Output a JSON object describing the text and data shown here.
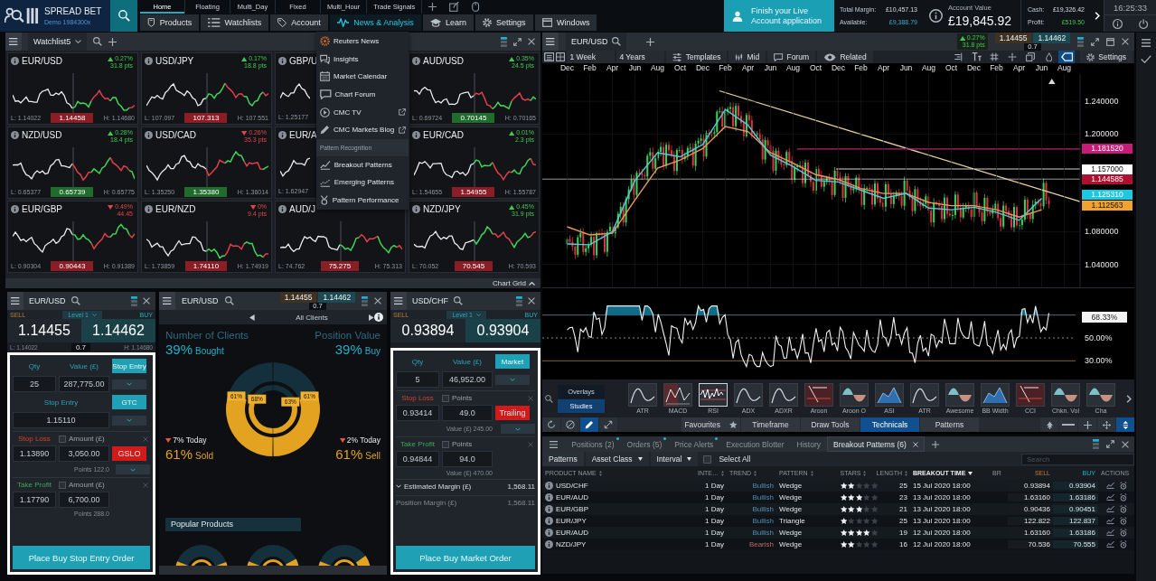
{
  "top_bar": {
    "logo": {
      "title": "SPREAD BET",
      "subtitle": "Demo 1984300x"
    },
    "layout_tabs": [
      {
        "label": "Home",
        "selected": true
      },
      {
        "label": "Floating",
        "selected": false
      },
      {
        "label": "Multi_Day",
        "selected": false
      },
      {
        "label": "Fixed",
        "selected": false
      },
      {
        "label": "Multi_Hour",
        "selected": false
      },
      {
        "label": "Trade Signals",
        "selected": false
      }
    ],
    "menu_tabs": [
      {
        "label": "Products",
        "kind": "products",
        "selected": false
      },
      {
        "label": "Watchlists",
        "kind": "watchlists",
        "selected": false
      },
      {
        "label": "Account",
        "kind": "account",
        "selected": false
      },
      {
        "label": "News & Analysis",
        "kind": "news",
        "selected": true
      },
      {
        "label": "Learn",
        "kind": "learn",
        "selected": false
      },
      {
        "label": "Settings",
        "kind": "settings",
        "selected": false
      },
      {
        "label": "Windows",
        "kind": "windows",
        "selected": false
      }
    ],
    "promo": "Finish your Live Account application",
    "margin": [
      {
        "label": "Total Margin:",
        "value": "£10,457.13"
      },
      {
        "label": "Available:",
        "value": "£9,388.79"
      }
    ],
    "account_value": {
      "label": "Account Value",
      "value": "£19,845.92"
    },
    "cash": [
      {
        "label": "Cash:",
        "value": "£19,326.42"
      },
      {
        "label": "Profit:",
        "value": "£519.50"
      }
    ],
    "clock": "16:25:33"
  },
  "news_menu": {
    "items": [
      {
        "label": "Reuters News",
        "kind": "reuters",
        "external": false
      },
      {
        "label": "Insights",
        "kind": "insights",
        "external": false
      },
      {
        "label": "Market Calendar",
        "kind": "calendar",
        "external": false
      },
      {
        "label": "Chart Forum",
        "kind": "forum",
        "external": false
      },
      {
        "label": "CMC TV",
        "kind": "video",
        "external": true
      },
      {
        "label": "CMC Markets Blog",
        "kind": "blog",
        "external": true
      },
      {
        "label": "Pattern Recognition",
        "kind": "section"
      },
      {
        "label": "Breakout Patterns",
        "kind": "breakout",
        "external": false
      },
      {
        "label": "Emerging Patterns",
        "kind": "emerging",
        "external": false
      },
      {
        "label": "Pattern Performance",
        "kind": "performance",
        "external": false
      }
    ]
  },
  "watchlist": {
    "title": "Watchlist5",
    "footer": "Chart Grid",
    "tiles": [
      {
        "symbol": "EUR/USD",
        "up": true,
        "change": "0.27%",
        "points": "31.8 pts",
        "low": "L: 1.14022",
        "price": "1.14458",
        "price_up": false,
        "high": "H: 1.14680"
      },
      {
        "symbol": "USD/JPY",
        "up": true,
        "change": "0.17%",
        "points": "18.8 pts",
        "low": "L: 107.097",
        "price": "107.313",
        "price_up": false,
        "high": "H: 107.551"
      },
      {
        "symbol": "GBP/U",
        "low": "L: 1.25177"
      },
      {
        "symbol": "AUD/USD",
        "up": true,
        "change": "0.35%",
        "points": "24.5 pts",
        "low": "L: 0.69724",
        "price": "0.70145",
        "price_up": true,
        "high": "H: 0.70165"
      },
      {
        "symbol": "NZD/USD",
        "up": true,
        "change": "0.28%",
        "points": "18.4 pts",
        "low": "L: 0.65377",
        "price": "0.65739",
        "price_up": true,
        "high": "H: 0.65775"
      },
      {
        "symbol": "USD/CAD",
        "up": false,
        "change": "0.26%",
        "points": "35.3 pts",
        "low": "L: 1.35250",
        "price": "1.35380",
        "price_up": true,
        "high": "H: 1.36014"
      },
      {
        "symbol": "EUR/A",
        "low": "L: 1.62947"
      },
      {
        "symbol": "EUR/CAD",
        "up": true,
        "change": "0.01%",
        "points": "2.3 pts",
        "low": "L: 1.54655",
        "price": "1.54955",
        "price_up": false,
        "high": "H: 1.55787"
      },
      {
        "symbol": "EUR/GBP",
        "up": false,
        "change": "0.49%",
        "points": "44.45",
        "low": "L: 0.90304",
        "price": "0.90443",
        "price_up": false,
        "high": "H: 0.91389"
      },
      {
        "symbol": "EUR/NZD",
        "up": false,
        "change": "0%",
        "points": "9.4 pts",
        "low": "L: 1.73859",
        "price": "1.74110",
        "price_up": false,
        "high": "H: 1.74919"
      },
      {
        "symbol": "AUD/J",
        "low": "L: 74.762",
        "price": "75.275",
        "price_up": false,
        "high": "H: 75.313"
      },
      {
        "symbol": "NZD/JPY",
        "up": true,
        "change": "0.45%",
        "points": "31.9 pts",
        "low": "L: 70.052",
        "price": "70.545",
        "price_up": false,
        "high": "H: 70.593"
      }
    ]
  },
  "panels": [
    {
      "kind": "order",
      "symbol": "EUR/USD",
      "sell_label": "SELL",
      "depth_label": "Level 1",
      "buy_label": "BUY",
      "sell": "1.14455",
      "buy": "1.14462",
      "low": "L: 1.14022",
      "spread": "0.7",
      "high": "H: 1.14680",
      "form": {
        "highlighted": true,
        "qty_label": "Qty",
        "value_label": "Value (£)",
        "qty": "25",
        "value": "287,775.00",
        "order_type": "Stop Entry",
        "entry": {
          "label": "Stop Entry",
          "value": "1.15110",
          "expiry": "GTC"
        },
        "stop_loss": {
          "label": "Stop Loss",
          "checked": false,
          "unit": "Amount (£)",
          "price": "1.13890",
          "amount": "3,050.00",
          "mode": "GSLO",
          "note": "Points 122.0"
        },
        "take_profit": {
          "label": "Take Profit",
          "checked": false,
          "unit": "Amount (£)",
          "price": "1.17790",
          "amount": "6,700.00",
          "note": "Points 288.0"
        },
        "submit": "Place Buy Stop Entry Order"
      }
    },
    {
      "kind": "sentiment",
      "symbol": "EUR/USD",
      "sell": "1.14455",
      "buy": "1.14462",
      "spread": "0.7",
      "filter": "All Clients",
      "sides": [
        {
          "title": "Number of Clients",
          "percent": "39%",
          "word": "Bought",
          "change_up": false,
          "change": "7% Today",
          "bottom_percent": "61%",
          "bottom_word": "Sold"
        },
        {
          "title": "Position Value",
          "percent": "39%",
          "word": "Buy",
          "change_up": false,
          "change": "2% Today",
          "bottom_percent": "61%",
          "bottom_word": "Sell"
        }
      ],
      "gauge": {
        "outer": [
          "61%",
          "61%"
        ],
        "inner": [
          "68%",
          "63%"
        ]
      },
      "popular_title": "Popular Products"
    },
    {
      "kind": "order",
      "symbol": "USD/CHF",
      "sell_label": "SELL",
      "depth_label": "Level 1",
      "buy_label": "BUY",
      "sell": "0.93894",
      "buy": "0.93904",
      "form": {
        "highlighted": true,
        "qty_label": "Qty",
        "value_label": "Value (£)",
        "qty": "5",
        "value": "46,952.00",
        "order_type": "Market",
        "stop_loss": {
          "label": "Stop Loss",
          "checked": false,
          "unit": "Points",
          "price": "0.93414",
          "amount": "49.0",
          "mode": "Trailing",
          "note": "Value (£) 245.00"
        },
        "take_profit": {
          "label": "Take Profit",
          "checked": false,
          "unit": "Points",
          "price": "0.94844",
          "amount": "94.0",
          "note": "Value (£) 470.00"
        },
        "margins": [
          {
            "label": "Estimated Margin (£)",
            "value": "1,568.11",
            "expanded": true
          },
          {
            "label": "Position Margin (£)",
            "value": "1,568.11"
          }
        ],
        "submit": "Place Buy Market Order"
      }
    }
  ],
  "chart": {
    "symbol": "EUR/USD",
    "change_up": true,
    "change": "0.27%",
    "points": "31.8 pts",
    "sell": "1.14455",
    "buy": "1.14462",
    "spread": "0.7",
    "toolbar": [
      {
        "label": "1 Week",
        "kind": "dropdown"
      },
      {
        "label": "4 Years",
        "kind": "dropdown"
      },
      {
        "label": "Templates",
        "kind": "templates"
      },
      {
        "label": "Mid",
        "kind": "mid"
      },
      {
        "label": "Forum",
        "kind": "forum"
      },
      {
        "label": "Related",
        "kind": "related"
      }
    ],
    "toolbar_icons": [
      {
        "kind": "align",
        "selected": false
      },
      {
        "kind": "textsize",
        "selected": false
      },
      {
        "kind": "grid",
        "selected": false
      },
      {
        "kind": "crosshair",
        "selected": false
      },
      {
        "kind": "layers",
        "selected": false
      },
      {
        "kind": "drop",
        "selected": false
      },
      {
        "kind": "tag",
        "selected": true
      }
    ],
    "settings": "Settings",
    "chart_data": {
      "type": "line",
      "grid": true,
      "categories": [
        "Dec",
        "Feb",
        "Apr",
        "Jun",
        "Aug",
        "Oct",
        "Dec",
        "Feb",
        "Apr",
        "Jun",
        "Aug",
        "Oct",
        "Dec",
        "Feb",
        "Apr",
        "Jun",
        "Aug",
        "Oct",
        "Dec",
        "Feb",
        "Apr",
        "Jun",
        "Aug"
      ],
      "series": [
        {
          "color": "#58c9dc",
          "values": [
            1.065,
            1.064,
            1.08,
            1.143,
            1.177,
            1.172,
            1.187,
            1.23,
            1.211,
            1.174,
            1.16,
            1.143,
            1.141,
            1.131,
            1.121,
            1.127,
            1.109,
            1.107,
            1.11,
            1.104,
            1.094,
            1.121,
            null
          ]
        },
        {
          "color": "#e89a5c",
          "values": [
            1.086,
            1.076,
            1.078,
            1.119,
            1.158,
            1.168,
            1.182,
            1.209,
            1.203,
            1.177,
            1.164,
            1.15,
            1.144,
            1.133,
            1.127,
            1.127,
            1.116,
            1.112,
            1.112,
            1.107,
            1.098,
            1.107,
            null
          ]
        }
      ],
      "ylim": [
        1.0117,
        1.2735
      ],
      "yticks": [
        {
          "value": 1.24,
          "label": "1.240000"
        },
        {
          "value": 1.2,
          "label": "1.200000"
        },
        {
          "value": 1.08,
          "label": "1.080000"
        },
        {
          "value": 1.04,
          "label": "1.040000"
        }
      ]
    },
    "price_tags": [
      {
        "label": "1.181520",
        "color": "#c41c78"
      },
      {
        "label": "1.157000",
        "color": "#ffffff"
      },
      {
        "label": "1.144585",
        "color": "#b01030"
      },
      {
        "label": "1.125310",
        "color": "#1ec8e0"
      },
      {
        "label": "1.112563",
        "color": "#f0a330"
      }
    ],
    "oscillator": {
      "tag": "68.33%",
      "ticks": [
        "50.00%",
        "30.00%"
      ]
    }
  },
  "studies": {
    "modes": [
      {
        "label": "Overlays",
        "selected": false
      },
      {
        "label": "Studies",
        "selected": true
      }
    ],
    "items": [
      {
        "label": "ATR",
        "selected": false
      },
      {
        "label": "MACD",
        "selected": false
      },
      {
        "label": "RSI",
        "selected": true
      },
      {
        "label": "ADX",
        "selected": false
      },
      {
        "label": "ADXR",
        "selected": false
      },
      {
        "label": "Aroon",
        "selected": false
      },
      {
        "label": "Aroon O",
        "selected": false
      },
      {
        "label": "ASI",
        "selected": false
      },
      {
        "label": "ATR",
        "selected": false
      },
      {
        "label": "Awesome",
        "selected": false
      },
      {
        "label": "BB Width",
        "selected": false
      },
      {
        "label": "CCI",
        "selected": false
      },
      {
        "label": "Chkn. Vol",
        "selected": false
      },
      {
        "label": "Cha",
        "selected": false
      }
    ],
    "tool_icons": [
      {
        "kind": "refresh",
        "selected": false
      },
      {
        "kind": "cancel",
        "selected": false
      },
      {
        "kind": "pencil",
        "selected": true
      },
      {
        "kind": "arrows",
        "selected": false
      }
    ],
    "tool_tabs": [
      {
        "label": "Favourites",
        "selected": false
      },
      {
        "label": "Timeframe",
        "selected": false
      },
      {
        "label": "Draw Tools",
        "selected": false
      },
      {
        "label": "Technicals",
        "selected": true
      },
      {
        "label": "Patterns",
        "selected": false
      }
    ],
    "view_icons": [
      {
        "kind": "tree",
        "selected": false
      },
      {
        "kind": "minus",
        "selected": false
      },
      {
        "kind": "plus",
        "selected": false
      },
      {
        "kind": "move",
        "selected": false
      },
      {
        "kind": "fit",
        "selected": true
      }
    ]
  },
  "positions_panel": {
    "tabs": [
      {
        "label": "Positions (2)",
        "selected": false,
        "alert": true,
        "closable": false
      },
      {
        "label": "Orders (5)",
        "selected": false,
        "alert": true,
        "closable": false
      },
      {
        "label": "Price Alerts",
        "selected": false,
        "alert": true,
        "closable": false
      },
      {
        "label": "Execution Blotter",
        "selected": false,
        "alert": false,
        "closable": false
      },
      {
        "label": "History",
        "selected": false,
        "alert": false,
        "closable": false
      },
      {
        "label": "Breakout Patterns (6)",
        "selected": true,
        "alert": false,
        "closable": true
      }
    ],
    "filters": [
      {
        "label": "Patterns",
        "kind": "button"
      },
      {
        "label": "Asset Class",
        "kind": "dropdown"
      },
      {
        "label": "Interval",
        "kind": "dropdown"
      },
      {
        "label": "Select All",
        "kind": "checkbox",
        "checked": false
      }
    ],
    "search": {
      "placeholder": "Search"
    },
    "table": {
      "columns": [
        {
          "label": "PRODUCT NAME",
          "sortable": true,
          "sorted": false
        },
        {
          "label": "INTE…",
          "sortable": true,
          "sorted": false
        },
        {
          "label": "TREND",
          "sortable": true,
          "sorted": false
        },
        {
          "label": "PATTERN",
          "sortable": true,
          "sorted": false
        },
        {
          "label": "STARS",
          "sortable": true,
          "sorted": false
        },
        {
          "label": "LENGTH",
          "sortable": true,
          "sorted": false
        },
        {
          "label": "BREAKOUT TIME",
          "sortable": true,
          "sorted": true
        },
        {
          "label": "BR",
          "sortable": false,
          "sorted": false
        },
        {
          "label": "SELL",
          "sortable": false,
          "sorted": false
        },
        {
          "label": "BUY",
          "sortable": false,
          "sorted": false
        },
        {
          "label": "ACTIONS",
          "sortable": false,
          "sorted": false
        }
      ],
      "rows": [
        {
          "product": "USD/CHF",
          "interval": "1 Day",
          "trend": "Bullish",
          "kind": "bullish",
          "pattern": "Wedge",
          "stars": 2,
          "length": "25",
          "breakout_time": "15 Jul 2020 18:00",
          "sell": "0.93894",
          "buy": "0.93904"
        },
        {
          "product": "EUR/AUD",
          "interval": "1 Day",
          "trend": "Bullish",
          "kind": "bullish",
          "pattern": "Wedge",
          "stars": 3,
          "length": "23",
          "breakout_time": "13 Jul 2020 18:00",
          "sell": "1.63160",
          "buy": "1.63186"
        },
        {
          "product": "EUR/GBP",
          "interval": "1 Day",
          "trend": "Bullish",
          "kind": "bullish",
          "pattern": "Wedge",
          "stars": 3,
          "length": "21",
          "breakout_time": "13 Jul 2020 18:00",
          "sell": "0.90436",
          "buy": "0.90451"
        },
        {
          "product": "EUR/JPY",
          "interval": "1 Day",
          "trend": "Bullish",
          "kind": "bullish",
          "pattern": "Triangle",
          "stars": 1,
          "length": "25",
          "breakout_time": "13 Jul 2020 18:00",
          "sell": "122.822",
          "buy": "122.837"
        },
        {
          "product": "EUR/AUD",
          "interval": "1 Day",
          "trend": "Bullish",
          "kind": "bullish",
          "pattern": "Wedge",
          "stars": 4,
          "length": "19",
          "breakout_time": "12 Jul 2020 18:00",
          "sell": "1.63160",
          "buy": "1.63186"
        },
        {
          "product": "NZD/JPY",
          "interval": "1 Day",
          "trend": "Bearish",
          "kind": "bearish",
          "pattern": "Wedge",
          "stars": 2,
          "length": "16",
          "breakout_time": "12 Jul 2020 18:00",
          "sell": "70.536",
          "buy": "70.555"
        }
      ]
    }
  }
}
